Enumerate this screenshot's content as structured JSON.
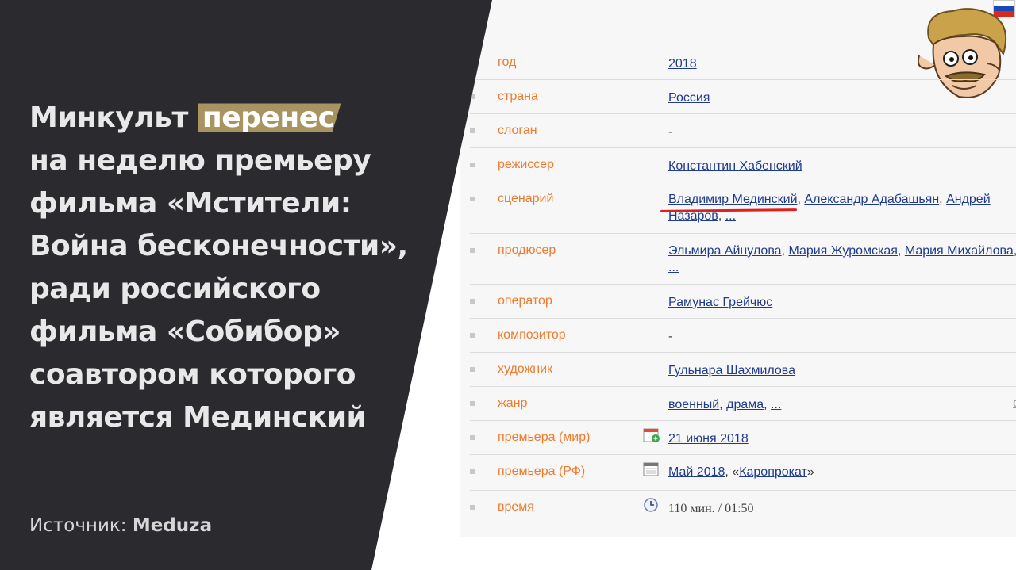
{
  "headline": {
    "lines": [
      "Минкульт",
      "перенес",
      "на неделю премьеру",
      "фильма «Мстители:",
      "Война бесконечности»,",
      "ради российского",
      "фильма «Собибор»",
      "соавтором которого",
      "является Мединский"
    ]
  },
  "source": {
    "label": "Источник:",
    "name": "Meduza"
  },
  "film": {
    "rows": [
      {
        "label": "год",
        "values": [
          "2018"
        ]
      },
      {
        "label": "страна",
        "values": [
          "Россия"
        ]
      },
      {
        "label": "слоган",
        "values": [
          "-"
        ]
      },
      {
        "label": "режиссер",
        "values": [
          "Константин Хабенский"
        ]
      },
      {
        "label": "сценарий",
        "values": [
          "Владимир Мединский",
          "Александр Адабашьян",
          "Андрей Назаров",
          "..."
        ]
      },
      {
        "label": "продюсер",
        "values": [
          "Эльмира Айнулова",
          "Мария Журомская",
          "Мария Михайлова",
          "..."
        ]
      },
      {
        "label": "оператор",
        "values": [
          "Рамунас Грейчюс"
        ]
      },
      {
        "label": "композитор",
        "values": [
          "-"
        ]
      },
      {
        "label": "художник",
        "values": [
          "Гульнара Шахмилова"
        ]
      },
      {
        "label": "жанр",
        "values": [
          "военный",
          "драма",
          "..."
        ],
        "side": "сл"
      },
      {
        "label": "премьера (мир)",
        "values": [
          "21 июня 2018"
        ]
      },
      {
        "label": "премьера (РФ)",
        "values": [
          "Май 2018",
          "Каропрокат"
        ]
      },
      {
        "label": "время",
        "values": [
          "110 мин. / 01:50"
        ]
      }
    ]
  },
  "colors": {
    "panel": "#2b2b2f",
    "highlight": "#a89460",
    "label_orange": "#f07a2e",
    "link_blue": "#1f3b8e",
    "underline_red": "#e0201b"
  },
  "icons": [
    "calendar-world-icon",
    "calendar-icon",
    "clock-icon",
    "russian-flag-icon",
    "mascot-caricature-icon"
  ]
}
